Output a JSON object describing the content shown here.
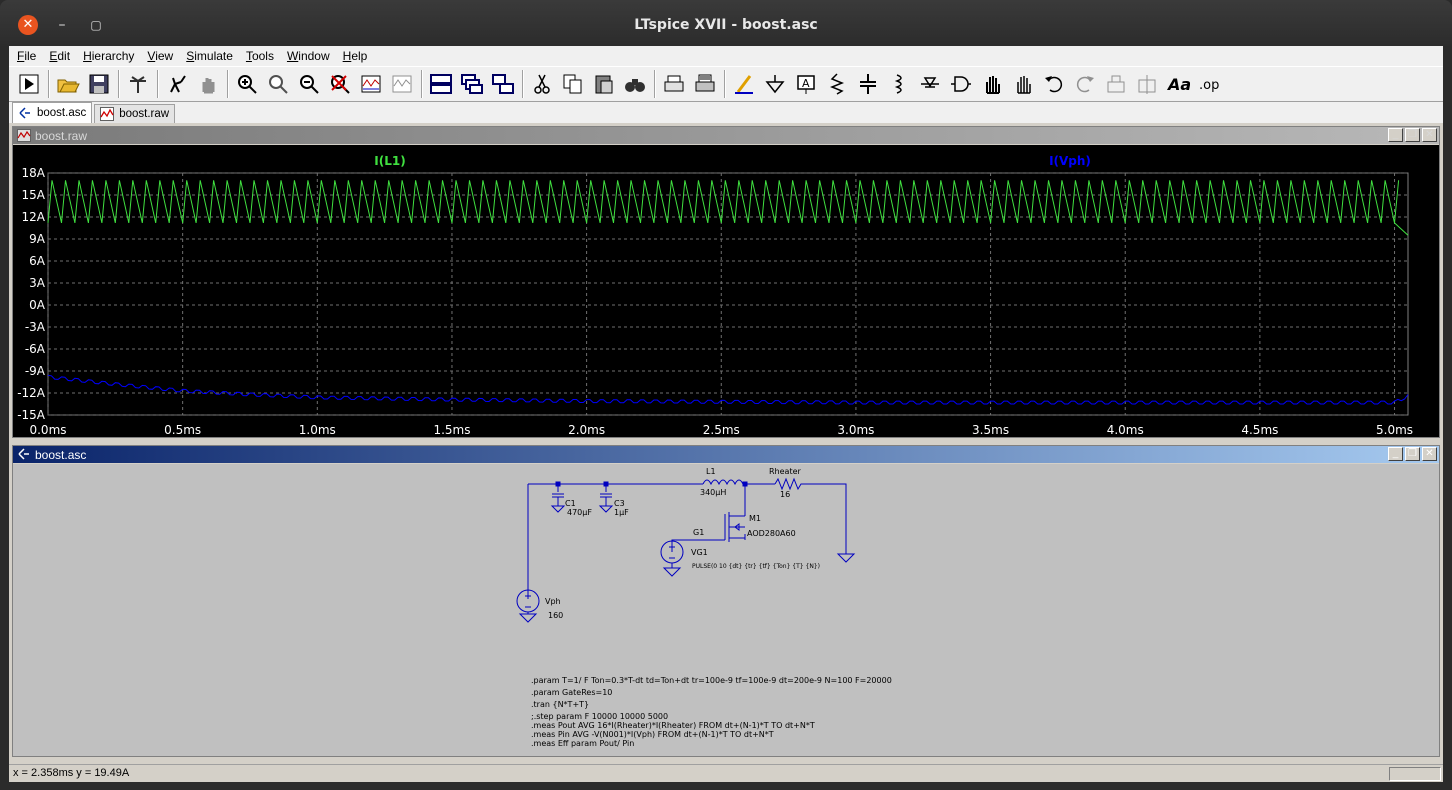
{
  "window": {
    "title": "LTspice XVII - boost.asc"
  },
  "menu": [
    "File",
    "Edit",
    "Hierarchy",
    "View",
    "Simulate",
    "Tools",
    "Window",
    "Help"
  ],
  "toolbar_icons": [
    "run-icon",
    "open-icon",
    "save-icon",
    "control-panel-icon",
    "halt-icon",
    "pan-icon",
    "zoom-in-icon",
    "zoom-fit-icon",
    "zoom-out-icon",
    "zoom-cancel-icon",
    "autorange-icon",
    "waveform-icon",
    "tile-horizontal-icon",
    "cascade-icon",
    "tile-vertical-icon",
    "cut-icon",
    "copy-icon",
    "paste-icon",
    "find-icon",
    "print-setup-icon",
    "print-icon",
    "draw-wire-icon",
    "ground-icon",
    "label-net-icon",
    "resistor-icon",
    "capacitor-icon",
    "inductor-icon",
    "diode-icon",
    "component-icon",
    "move-icon",
    "drag-icon",
    "undo-icon",
    "redo-icon",
    "rotate-icon",
    "mirror-icon",
    "text-icon",
    "spice-directive-icon"
  ],
  "tabs": [
    {
      "label": "boost.asc",
      "active": true
    },
    {
      "label": "boost.raw",
      "active": false
    }
  ],
  "plot_window": {
    "title": "boost.raw"
  },
  "schematic_window": {
    "title": "boost.asc"
  },
  "chart_data": {
    "type": "line",
    "xlabel": "",
    "ylabel": "",
    "x_ticks": [
      "0.0ms",
      "0.5ms",
      "1.0ms",
      "1.5ms",
      "2.0ms",
      "2.5ms",
      "3.0ms",
      "3.5ms",
      "4.0ms",
      "4.5ms",
      "5.0ms"
    ],
    "y_ticks": [
      "18A",
      "15A",
      "12A",
      "9A",
      "6A",
      "3A",
      "0A",
      "-3A",
      "-6A",
      "-9A",
      "-12A",
      "-15A"
    ],
    "xlim": [
      0,
      5.05
    ],
    "ylim": [
      -15,
      18
    ],
    "grid": true,
    "series": [
      {
        "name": "I(L1)",
        "color": "#40e040",
        "shape": "sawtooth",
        "period_ms": 0.05,
        "min": 11.2,
        "max": 17.0,
        "end_value": 9.5
      },
      {
        "name": "I(Vph)",
        "color": "#0000ff",
        "shape": "decaying-ripple",
        "x": [
          0.0,
          0.1,
          0.25,
          0.5,
          0.75,
          1.0,
          1.5,
          2.0,
          2.5,
          3.0,
          4.0,
          5.0,
          5.05
        ],
        "y": [
          -9.8,
          -10.2,
          -10.8,
          -11.7,
          -12.2,
          -12.6,
          -12.9,
          -13.1,
          -13.2,
          -13.3,
          -13.3,
          -13.3,
          -12.4
        ],
        "ripple": 0.4
      }
    ]
  },
  "schematic": {
    "components": {
      "L1": {
        "name": "L1",
        "value": "340µH"
      },
      "Rheater": {
        "name": "Rheater",
        "value": "16"
      },
      "C1": {
        "name": "C1",
        "value": "470µF"
      },
      "C3": {
        "name": "C3",
        "value": "1µF"
      },
      "M1": {
        "name": "M1",
        "value": "AOD280A60"
      },
      "G1": {
        "name": "G1"
      },
      "VG1": {
        "name": "VG1",
        "value": "PULSE(0 10 {dt} {tr} {tf} {Ton} {T} {N})"
      },
      "Vph": {
        "name": "Vph",
        "value": "160"
      }
    },
    "directives": [
      ".param T=1/ F Ton=0.3*T-dt td=Ton+dt tr=100e-9 tf=100e-9 dt=200e-9 N=100 F=20000",
      ".param GateRes=10",
      ".tran {N*T+T}",
      ";.step param F 10000 10000 5000",
      ".meas Pout AVG 16*I(Rheater)*I(Rheater) FROM dt+(N-1)*T TO dt+N*T",
      ".meas Pin AVG -V(N001)*I(Vph) FROM dt+(N-1)*T TO dt+N*T",
      ".meas Eff param Pout/ Pin"
    ]
  },
  "status": {
    "cursor": "x = 2.358ms    y = 19.49A"
  }
}
